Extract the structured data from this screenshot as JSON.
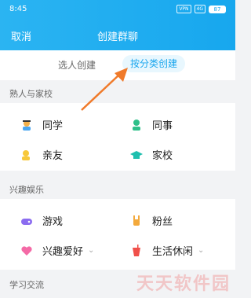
{
  "status": {
    "time": "8:45",
    "vpn": "VPN",
    "net": "4G",
    "battery": "87"
  },
  "header": {
    "cancel": "取消",
    "title": "创建群聊"
  },
  "tabs": [
    {
      "label": "选人创建"
    },
    {
      "label": "按分类创建"
    }
  ],
  "sections": [
    {
      "title": "熟人与家校",
      "items": [
        {
          "label": "同学"
        },
        {
          "label": "同事"
        },
        {
          "label": "亲友"
        },
        {
          "label": "家校"
        }
      ]
    },
    {
      "title": "兴趣娱乐",
      "items": [
        {
          "label": "游戏"
        },
        {
          "label": "粉丝"
        },
        {
          "label": "兴趣爱好"
        },
        {
          "label": "生活休闲"
        }
      ]
    },
    {
      "title": "学习交流"
    }
  ],
  "colors": {
    "accent": "#1aa6ee",
    "arrow": "#f07a2a"
  },
  "watermark": "天天软件园"
}
